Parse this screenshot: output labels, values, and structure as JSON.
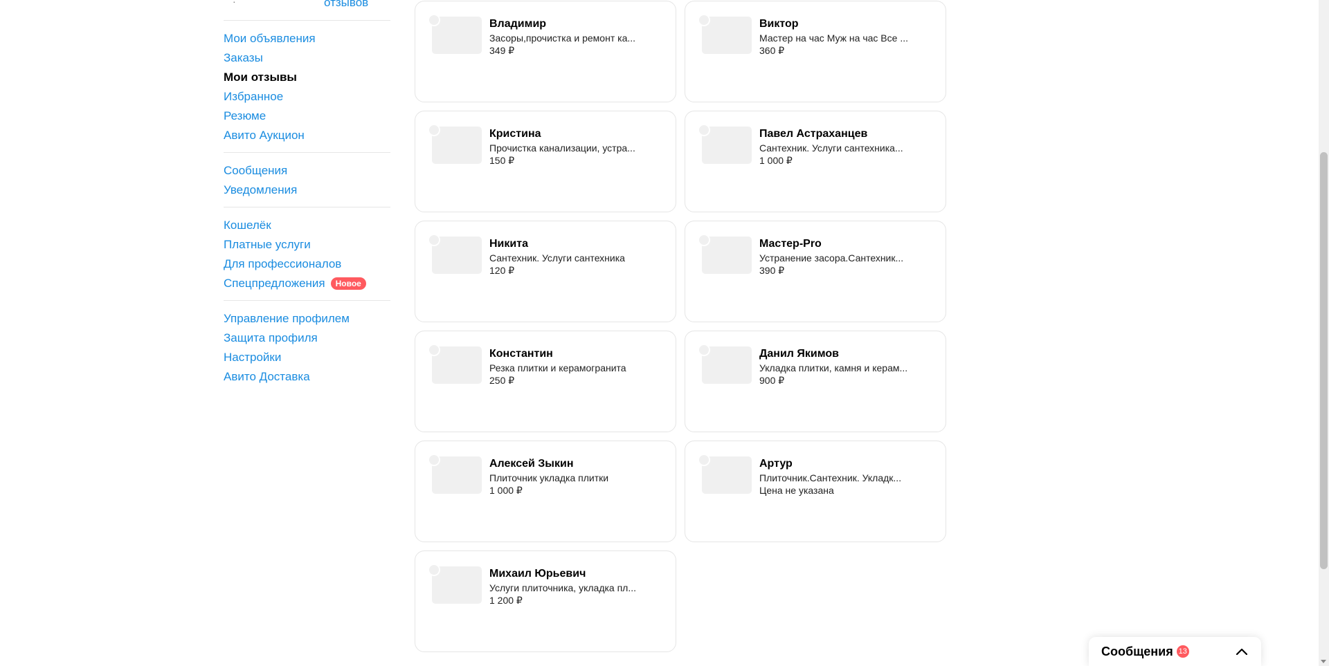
{
  "sidebar": {
    "top_dot": "·",
    "reviews_link": "отзывов",
    "groups": [
      [
        {
          "label": "Мои объявления",
          "active": false
        },
        {
          "label": "Заказы",
          "active": false
        },
        {
          "label": "Мои отзывы",
          "active": true
        },
        {
          "label": "Избранное",
          "active": false
        },
        {
          "label": "Резюме",
          "active": false
        },
        {
          "label": "Авито Аукцион",
          "active": false
        }
      ],
      [
        {
          "label": "Сообщения",
          "active": false
        },
        {
          "label": "Уведомления",
          "active": false
        }
      ],
      [
        {
          "label": "Кошелёк",
          "active": false
        },
        {
          "label": "Платные услуги",
          "active": false
        },
        {
          "label": "Для профессионалов",
          "active": false
        },
        {
          "label": "Спецпредложения",
          "active": false,
          "badge": "Новое"
        }
      ],
      [
        {
          "label": "Управление профилем",
          "active": false
        },
        {
          "label": "Защита профиля",
          "active": false
        },
        {
          "label": "Настройки",
          "active": false
        },
        {
          "label": "Авито Доставка",
          "active": false
        }
      ]
    ]
  },
  "cards": [
    {
      "name": "Владимир",
      "desc": "Засоры,прочистка и ремонт ка...",
      "price": "349 ₽"
    },
    {
      "name": "Виктор",
      "desc": "Мастер на час Муж на час Все ...",
      "price": "360 ₽"
    },
    {
      "name": "Кристина",
      "desc": "Прочистка канализации, устра...",
      "price": "150 ₽"
    },
    {
      "name": "Павел Астраханцев",
      "desc": "Сантехник. Услуги сантехника...",
      "price": "1 000 ₽"
    },
    {
      "name": "Никита",
      "desc": "Сантехник. Услуги сантехника",
      "price": "120 ₽"
    },
    {
      "name": "Мастер-Pro",
      "desc": "Устранение засора.Сантехник...",
      "price": "390 ₽"
    },
    {
      "name": "Константин",
      "desc": "Резка плитки и керамогранита",
      "price": "250 ₽"
    },
    {
      "name": "Данил Якимов",
      "desc": "Укладка плитки, камня и керам...",
      "price": "900 ₽"
    },
    {
      "name": "Алексей Зыкин",
      "desc": "Плиточник укладка плитки",
      "price": "1 000 ₽"
    },
    {
      "name": "Артур",
      "desc": "Плиточник.Сантехник. Укладк...",
      "price": "Цена не указана"
    },
    {
      "name": "Михаил Юрьевич",
      "desc": "Услуги плиточника, укладка пл...",
      "price": "1 200 ₽"
    }
  ],
  "messenger": {
    "title": "Сообщения",
    "count": "13",
    "chevron_icon": "chevron-up-icon"
  },
  "colors": {
    "link": "#1a8ce0",
    "badge": "#ff5a5f"
  }
}
